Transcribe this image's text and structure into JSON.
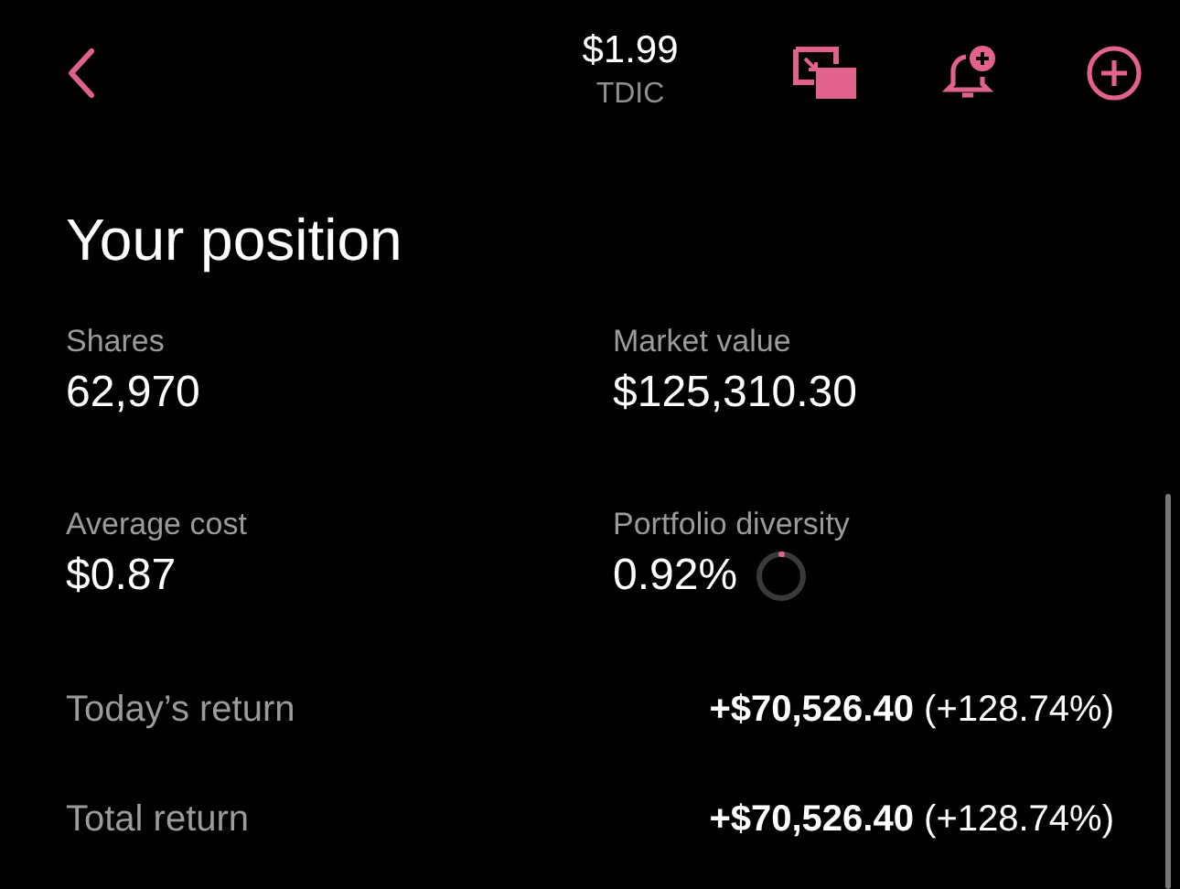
{
  "header": {
    "price": "$1.99",
    "ticker": "TDIC"
  },
  "title": "Your position",
  "stats": [
    {
      "label": "Shares",
      "value": "62,970"
    },
    {
      "label": "Market value",
      "value": "$125,310.30"
    },
    {
      "label": "Average cost",
      "value": "$0.87"
    },
    {
      "label": "Portfolio diversity",
      "value": "0.92%"
    }
  ],
  "returns": [
    {
      "label": "Today’s return",
      "value": "**+$70,526.40** (+128.74%)"
    },
    {
      "label": "Total return",
      "value": "**+$70,526.40** (+128.74%)"
    }
  ]
}
